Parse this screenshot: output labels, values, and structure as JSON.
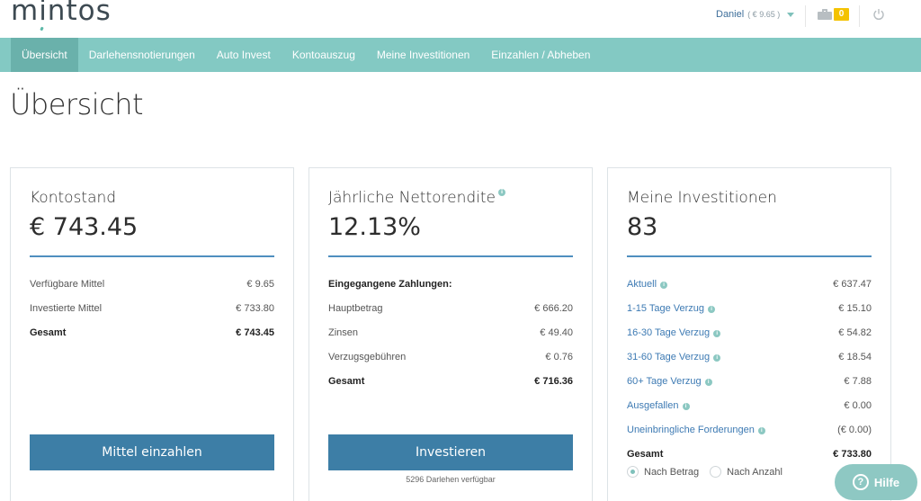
{
  "header": {
    "logo": "mintos",
    "user_name": "Daniel",
    "user_balance": "( € 9.65 )",
    "notifications_count": "0"
  },
  "nav": {
    "items": [
      {
        "label": "Übersicht",
        "active": true
      },
      {
        "label": "Darlehensnotierungen"
      },
      {
        "label": "Auto Invest"
      },
      {
        "label": "Kontoauszug"
      },
      {
        "label": "Meine Investitionen"
      },
      {
        "label": "Einzahlen / Abheben"
      }
    ]
  },
  "page_title": "Übersicht",
  "cards": {
    "balance": {
      "title": "Kontostand",
      "value": "€ 743.45",
      "rows": [
        {
          "label": "Verfügbare Mittel",
          "value": "€ 9.65"
        },
        {
          "label": "Investierte Mittel",
          "value": "€ 733.80"
        },
        {
          "label": "Gesamt",
          "value": "€ 743.45"
        }
      ],
      "button": "Mittel einzahlen"
    },
    "return": {
      "title": "Jährliche Nettorendite",
      "value": "12.13%",
      "section_heading": "Eingegangene Zahlungen:",
      "rows": [
        {
          "label": "Hauptbetrag",
          "value": "€ 666.20"
        },
        {
          "label": "Zinsen",
          "value": "€ 49.40"
        },
        {
          "label": "Verzugsgebühren",
          "value": "€ 0.76"
        },
        {
          "label": "Gesamt",
          "value": "€ 716.36"
        }
      ],
      "button": "Investieren",
      "available_text": "5296 Darlehen verfügbar"
    },
    "investments": {
      "title": "Meine Investitionen",
      "value": "83",
      "rows": [
        {
          "label": "Aktuell",
          "value": "€ 637.47"
        },
        {
          "label": "1-15 Tage Verzug",
          "value": "€ 15.10"
        },
        {
          "label": "16-30 Tage Verzug",
          "value": "€ 54.82"
        },
        {
          "label": "31-60 Tage Verzug",
          "value": "€ 18.54"
        },
        {
          "label": "60+ Tage Verzug",
          "value": "€ 7.88"
        },
        {
          "label": "Ausgefallen",
          "value": "€ 0.00"
        },
        {
          "label": "Uneinbringliche Forderungen",
          "value": "(€ 0.00)"
        },
        {
          "label": "Gesamt",
          "value": "€ 733.80"
        }
      ],
      "radio_by_amount": "Nach Betrag",
      "radio_by_count": "Nach Anzahl"
    }
  },
  "help_label": "Hilfe",
  "colors": {
    "nav_bg": "#83c9c3",
    "nav_active": "#6ab1ab",
    "button": "#3d7ea6",
    "accent_line": "#4f8fbf",
    "link": "#3d7ab3",
    "badge": "#f4c200"
  }
}
